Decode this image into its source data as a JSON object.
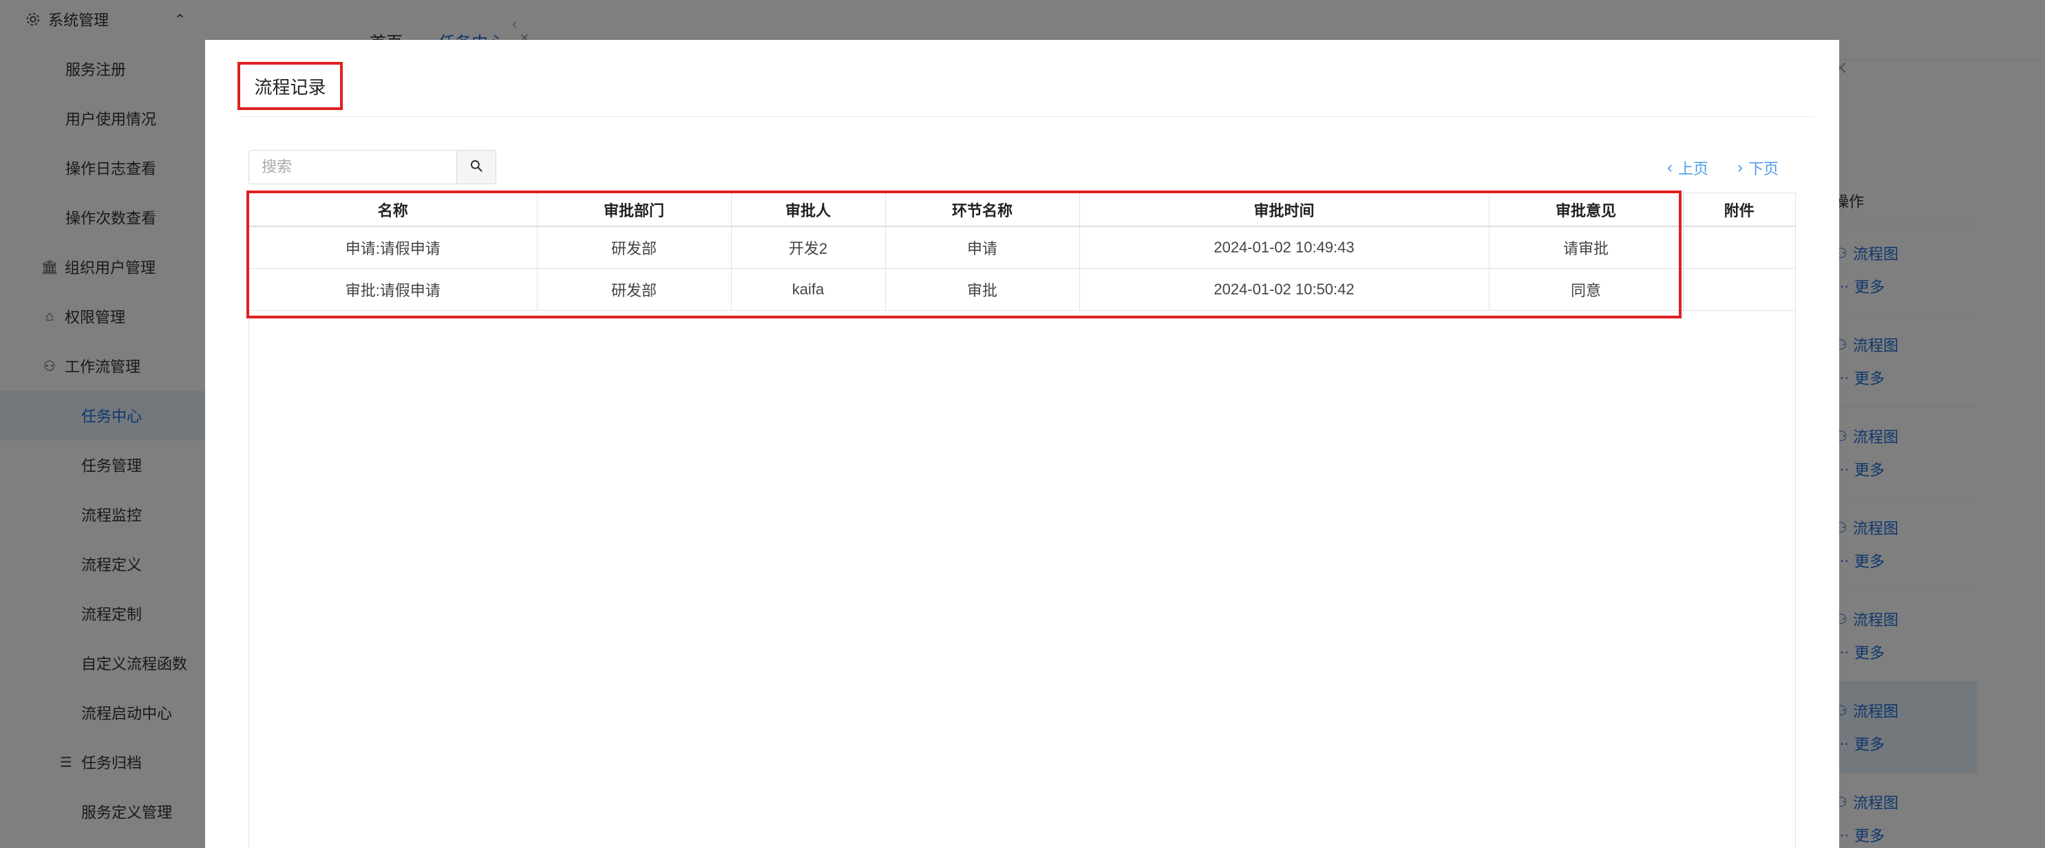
{
  "sidebar": {
    "items": [
      {
        "label": "系统管理",
        "icon": "gear-icon"
      },
      {
        "label": "服务注册"
      },
      {
        "label": "用户使用情况"
      },
      {
        "label": "操作日志查看"
      },
      {
        "label": "操作次数查看"
      },
      {
        "label": "组织用户管理",
        "icon": "bank-icon"
      },
      {
        "label": "权限管理",
        "icon": "lock-icon"
      },
      {
        "label": "工作流管理",
        "icon": "flow-icon"
      },
      {
        "label": "任务中心"
      },
      {
        "label": "任务管理"
      },
      {
        "label": "流程监控"
      },
      {
        "label": "流程定义"
      },
      {
        "label": "流程定制"
      },
      {
        "label": "自定义流程函数"
      },
      {
        "label": "流程启动中心"
      },
      {
        "label": "任务归档",
        "icon": "archive-icon"
      },
      {
        "label": "服务定义管理"
      }
    ]
  },
  "tabs": [
    {
      "label": "首页"
    },
    {
      "label": "任务中心",
      "close": "×"
    }
  ],
  "ops": {
    "header": "操作",
    "flow_label": "流程图",
    "more_label": "更多"
  },
  "modal": {
    "title": "流程记录",
    "close": "×",
    "search_placeholder": "搜索",
    "prev_label": "上页",
    "next_label": "下页",
    "columns": [
      "名称",
      "审批部门",
      "审批人",
      "环节名称",
      "审批时间",
      "审批意见",
      "附件"
    ],
    "rows": [
      [
        "申请:请假申请",
        "研发部",
        "开发2",
        "申请",
        "2024-01-02 10:49:43",
        "请审批",
        ""
      ],
      [
        "审批:请假申请",
        "研发部",
        "kaifa",
        "审批",
        "2024-01-02 10:50:42",
        "同意",
        ""
      ]
    ]
  },
  "colors": {
    "accent": "#1e6fd9",
    "highlight_border": "#e02020",
    "pager": "#4a9be8"
  }
}
